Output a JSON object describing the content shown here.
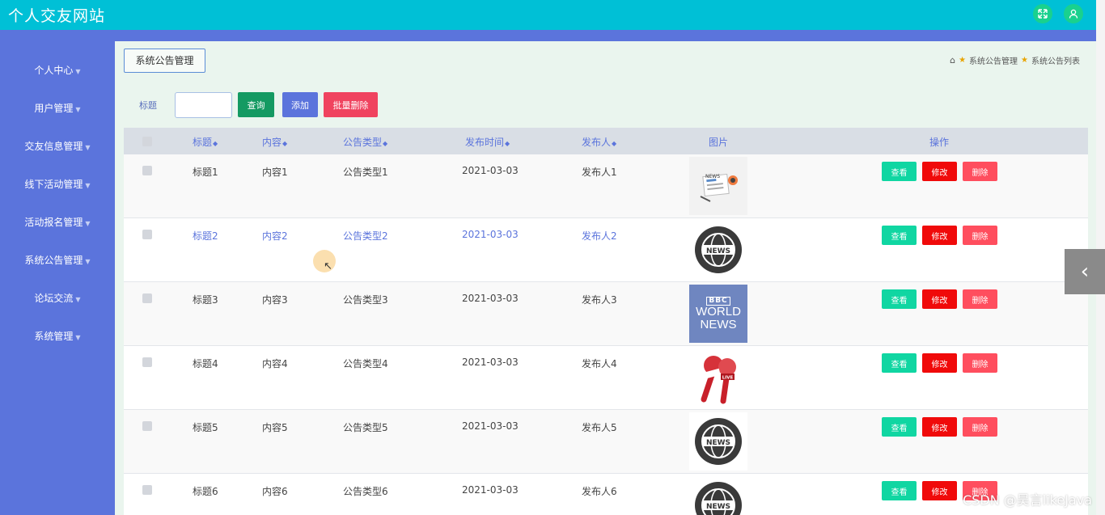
{
  "header": {
    "site_title": "个人交友网站",
    "fullscreen_icon": "expand-icon",
    "user_icon": "user-icon"
  },
  "sidebar": {
    "items": [
      {
        "label": "个人中心"
      },
      {
        "label": "用户管理"
      },
      {
        "label": "交友信息管理"
      },
      {
        "label": "线下活动管理"
      },
      {
        "label": "活动报名管理"
      },
      {
        "label": "系统公告管理"
      },
      {
        "label": "论坛交流"
      },
      {
        "label": "系统管理"
      }
    ]
  },
  "page": {
    "title": "系统公告管理",
    "breadcrumb": [
      "系统公告管理",
      "系统公告列表"
    ]
  },
  "search": {
    "label": "标题",
    "value": "",
    "query_button": "查询",
    "add_button": "添加",
    "bulk_delete_button": "批量删除"
  },
  "table": {
    "columns": [
      "标题",
      "内容",
      "公告类型",
      "发布时间",
      "发布人",
      "图片",
      "操作"
    ],
    "rows": [
      {
        "title": "标题1",
        "content": "内容1",
        "type": "公告类型1",
        "time": "2021-03-03",
        "publisher": "发布人1",
        "image": "news-icon"
      },
      {
        "title": "标题2",
        "content": "内容2",
        "type": "公告类型2",
        "time": "2021-03-03",
        "publisher": "发布人2",
        "image": "news-globe-icon"
      },
      {
        "title": "标题3",
        "content": "内容3",
        "type": "公告类型3",
        "time": "2021-03-03",
        "publisher": "发布人3",
        "image": "bbc-news-logo"
      },
      {
        "title": "标题4",
        "content": "内容4",
        "type": "公告类型4",
        "time": "2021-03-03",
        "publisher": "发布人4",
        "image": "microphone-icon"
      },
      {
        "title": "标题5",
        "content": "内容5",
        "type": "公告类型5",
        "time": "2021-03-03",
        "publisher": "发布人5",
        "image": "news-globe-icon"
      },
      {
        "title": "标题6",
        "content": "内容6",
        "type": "公告类型6",
        "time": "2021-03-03",
        "publisher": "发布人6",
        "image": "news-globe-icon"
      }
    ],
    "actions": {
      "view": "查看",
      "edit": "修改",
      "delete": "删除"
    }
  },
  "images": {
    "bbc_line1": "BBC",
    "bbc_line2": "WORLD",
    "bbc_line3": "NEWS",
    "news_text": "NEWS",
    "live_text": "LIVE"
  },
  "watermark": "CSDN @昊言likeJava",
  "colors": {
    "header": "#00c0d6",
    "sidebar": "#5b74dc",
    "view": "#10d6a2",
    "edit": "#f00a0a",
    "delete": "#ff4e5e"
  }
}
